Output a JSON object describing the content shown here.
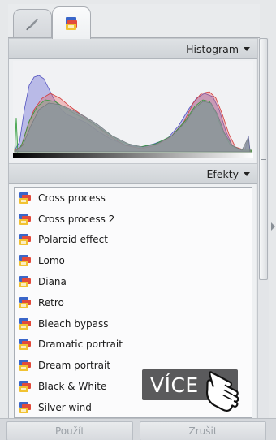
{
  "tabs": [
    {
      "name": "adjust-tab",
      "icon": "brush-icon"
    },
    {
      "name": "effects-tab",
      "icon": "effects-stack-icon"
    }
  ],
  "histogram": {
    "label": "Histogram",
    "colors": {
      "blue": "#6f6fd6",
      "red": "#e45a5a",
      "green": "#3fb24a",
      "gray": "#8d959c"
    }
  },
  "effects": {
    "label": "Efekty",
    "items": [
      "Cross process",
      "Cross process 2",
      "Polaroid effect",
      "Lomo",
      "Diana",
      "Retro",
      "Bleach bypass",
      "Dramatic portrait",
      "Dream portrait",
      "Black & White",
      "Silver wind"
    ]
  },
  "buttons": {
    "apply": "Použít",
    "cancel": "Zrušit"
  },
  "overlay": {
    "more_label": "VÍCE"
  }
}
